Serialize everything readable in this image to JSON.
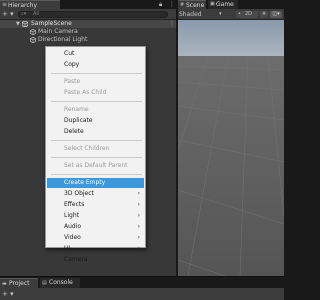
{
  "hierarchy": {
    "tab_label": "Hierarchy",
    "tab_icon": "hierarchy-icon",
    "lock_icon": "lock-icon",
    "menu_icon": "kebab-menu-icon",
    "add_button": "+ ▾",
    "search_icon": "search-icon",
    "search_text": "All",
    "scene": {
      "label": "SampleScene",
      "icon": "unity-scene-icon"
    },
    "objects": [
      {
        "label": "Main Camera",
        "icon": "cube-icon"
      },
      {
        "label": "Directional Light",
        "icon": "cube-icon"
      }
    ]
  },
  "scene_view": {
    "tabs": [
      {
        "label": "Scene",
        "icon": "scene-icon"
      },
      {
        "label": "Game",
        "icon": "game-icon"
      }
    ],
    "shading_mode": "Shaded",
    "mode_2d": "2D",
    "light_icon": "light-bulb-icon",
    "fx_icon": "effects-icon"
  },
  "bottom": {
    "tabs": [
      {
        "label": "Project",
        "icon": "folder-icon"
      },
      {
        "label": "Console",
        "icon": "console-icon"
      }
    ],
    "add_button": "+ ▾"
  },
  "context_menu": {
    "items": [
      {
        "label": "Cut",
        "enabled": true,
        "submenu": false
      },
      {
        "label": "Copy",
        "enabled": true,
        "submenu": false
      },
      {
        "label": "Paste",
        "enabled": false,
        "submenu": false
      },
      {
        "label": "Paste As Child",
        "enabled": false,
        "submenu": false
      },
      {
        "label": "Rename",
        "enabled": false,
        "submenu": false
      },
      {
        "label": "Duplicate",
        "enabled": true,
        "submenu": false
      },
      {
        "label": "Delete",
        "enabled": true,
        "submenu": false
      },
      {
        "label": "Select Children",
        "enabled": false,
        "submenu": false
      },
      {
        "label": "Set as Default Parent",
        "enabled": false,
        "submenu": false
      },
      {
        "label": "Create Empty",
        "enabled": true,
        "submenu": false,
        "highlighted": true
      },
      {
        "label": "3D Object",
        "enabled": true,
        "submenu": true
      },
      {
        "label": "Effects",
        "enabled": true,
        "submenu": true
      },
      {
        "label": "Light",
        "enabled": true,
        "submenu": true
      },
      {
        "label": "Audio",
        "enabled": true,
        "submenu": true
      },
      {
        "label": "Video",
        "enabled": true,
        "submenu": true
      },
      {
        "label": "UI",
        "enabled": true,
        "submenu": true
      },
      {
        "label": "Camera",
        "enabled": true,
        "submenu": false
      }
    ],
    "submenu_arrow": "›"
  },
  "colors": {
    "panel_bg": "#383838",
    "selection_row": "#464646",
    "menu_bg": "#f2f2f2",
    "menu_highlight": "#3d97d8",
    "sky_top": "#8a9aab",
    "ground": "#5d5d5d"
  }
}
